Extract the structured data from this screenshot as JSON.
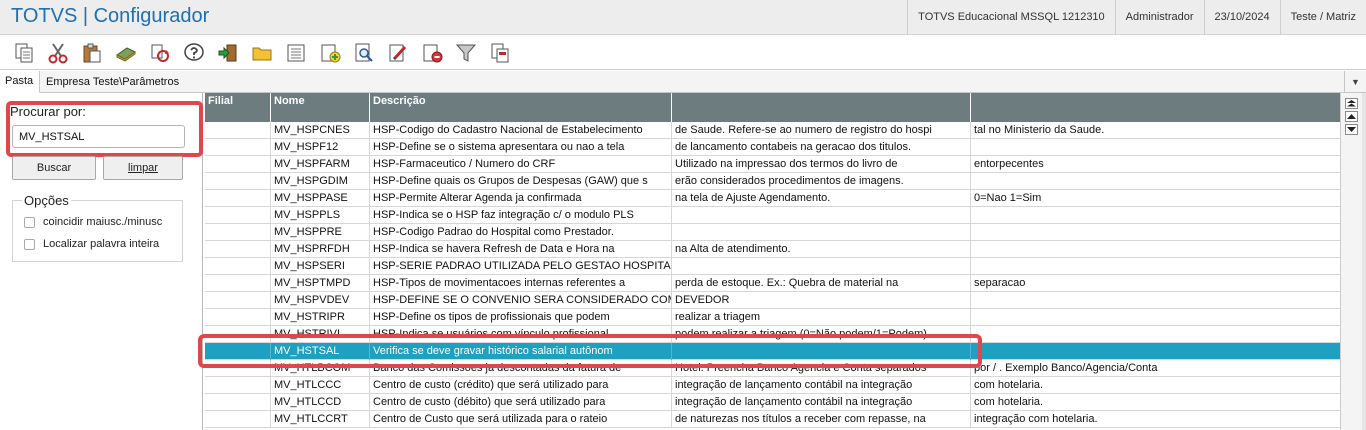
{
  "app": {
    "title": "TOTVS | Configurador",
    "status": [
      "TOTVS Educacional MSSQL 1212310",
      "Administrador",
      "23/10/2024",
      "Teste / Matriz"
    ]
  },
  "toolbar": {
    "icons": [
      "copy-icon",
      "cut-icon",
      "paste-icon",
      "money-icon",
      "refresh-icon",
      "help-icon",
      "exit-icon",
      "folder-icon",
      "list-icon",
      "add-icon",
      "search-doc-icon",
      "edit-icon",
      "delete-icon",
      "filter-icon",
      "print-icon"
    ]
  },
  "tabs": {
    "pasta": "Pasta",
    "path": "Empresa Teste\\Parâmetros"
  },
  "search": {
    "label": "Procurar por:",
    "value": "MV_HSTSAL",
    "buscar": "Buscar",
    "limpar": "limpar"
  },
  "options": {
    "title": "Opções",
    "match_case": "coincidir maiusc./minusc",
    "whole_word": "Localizar palavra inteira"
  },
  "grid": {
    "columns": [
      "Filial",
      "Nome",
      "Descrição",
      "",
      ""
    ],
    "rows": [
      [
        "",
        "MV_HSPCNES",
        "HSP-Codigo do Cadastro Nacional de Estabelecimento",
        "de Saude. Refere-se ao numero de registro do hospi",
        "tal no Ministerio da Saude."
      ],
      [
        "",
        "MV_HSPF12",
        "HSP-Define se o sistema apresentara ou nao a tela",
        "de lancamento contabeis na geracao dos titulos.",
        ""
      ],
      [
        "",
        "MV_HSPFARM",
        "HSP-Farmaceutico / Numero do CRF",
        "Utilizado na impressao dos termos do livro de",
        "entorpecentes"
      ],
      [
        "",
        "MV_HSPGDIM",
        "HSP-Define quais os Grupos de Despesas (GAW) que s",
        "erão considerados procedimentos de imagens.",
        ""
      ],
      [
        "",
        "MV_HSPPASE",
        "HSP-Permite Alterar Agenda ja confirmada",
        "na tela de Ajuste Agendamento.",
        "0=Nao 1=Sim"
      ],
      [
        "",
        "MV_HSPPLS",
        "HSP-Indica se o HSP faz integração c/ o modulo PLS",
        "",
        ""
      ],
      [
        "",
        "MV_HSPPRE",
        "HSP-Codigo Padrao do Hospital como Prestador.",
        "",
        ""
      ],
      [
        "",
        "MV_HSPRFDH",
        "HSP-Indica se havera Refresh de Data e Hora na",
        "na Alta de atendimento.",
        ""
      ],
      [
        "",
        "MV_HSPSERI",
        "HSP-SERIE PADRAO UTILIZADA PELO GESTAO HOSPITALAR",
        "",
        ""
      ],
      [
        "",
        "MV_HSPTMPD",
        "HSP-Tipos de movimentacoes internas referentes a",
        "perda de estoque. Ex.: Quebra de material na",
        "separacao"
      ],
      [
        "",
        "MV_HSPVDEV",
        "HSP-DEFINE SE O CONVENIO SERA CONSIDERADO COMO",
        "DEVEDOR",
        ""
      ],
      [
        "",
        "MV_HSTRIPR",
        "HSP-Define os tipos de profissionais que podem",
        "realizar a triagem",
        ""
      ],
      [
        "",
        "MV_HSTRIVI",
        "HSP-Indica se usuários com vínculo profissional",
        "podem realizar a triagem (0=Não podem/1=Podem)",
        ""
      ],
      [
        "",
        "MV_HSTSAL",
        "Verifica se deve gravar histórico salarial autônom",
        "",
        ""
      ],
      [
        "",
        "MV_HTLBCOM",
        "Banco das Comissoes ja descontadas da fatura de",
        "Hotel. Preencha Banco Agencia e Conta separados",
        "por / . Exemplo Banco/Agencia/Conta"
      ],
      [
        "",
        "MV_HTLCCC",
        "Centro de custo (crédito) que será utilizado para",
        " integração de lançamento contábil na integração",
        "com hotelaria."
      ],
      [
        "",
        "MV_HTLCCD",
        "Centro de custo (débito) que será utilizado para",
        "integração de lançamento contábil na integração",
        "com hotelaria."
      ],
      [
        "",
        "MV_HTLCCRT",
        "Centro de Custo que será utilizada para o rateio",
        "de naturezas nos títulos a receber com repasse, na",
        "integração com hotelaria."
      ]
    ],
    "selected_row": 13
  },
  "colors": {
    "title": "#1e6fb3",
    "header_bg": "#6d7c7f",
    "selected_bg": "#1ea0c0",
    "highlight": "#e0474c"
  }
}
